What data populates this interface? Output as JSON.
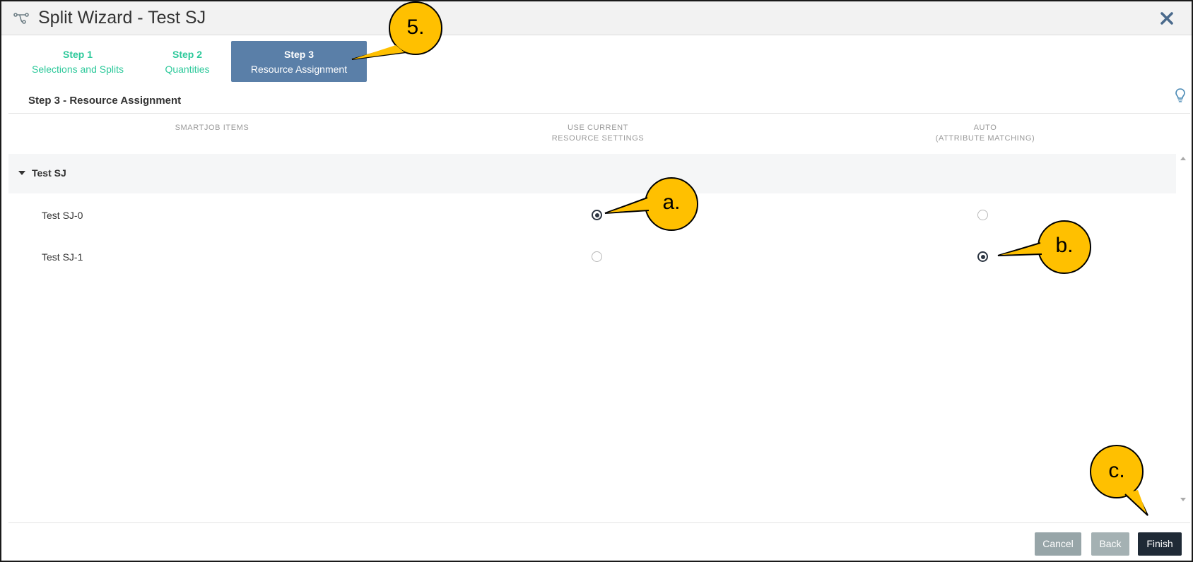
{
  "window": {
    "title": "Split Wizard - Test SJ"
  },
  "steps": [
    {
      "num": "Step 1",
      "label": "Selections and Splits",
      "state": "done"
    },
    {
      "num": "Step 2",
      "label": "Quantities",
      "state": "done"
    },
    {
      "num": "Step 3",
      "label": "Resource Assignment",
      "state": "active"
    }
  ],
  "section": {
    "title": "Step 3 - Resource Assignment"
  },
  "columns": {
    "items": "SMARTJOB ITEMS",
    "current_line1": "USE CURRENT",
    "current_line2": "RESOURCE SETTINGS",
    "auto_line1": "AUTO",
    "auto_line2": "(ATTRIBUTE MATCHING)"
  },
  "group": {
    "label": "Test SJ"
  },
  "rows": [
    {
      "label": "Test SJ-0",
      "use_current": true,
      "auto": false
    },
    {
      "label": "Test SJ-1",
      "use_current": false,
      "auto": true
    }
  ],
  "buttons": {
    "cancel": "Cancel",
    "back": "Back",
    "finish": "Finish"
  },
  "callouts": {
    "step": "5.",
    "a": "a.",
    "b": "b.",
    "c": "c."
  },
  "colors": {
    "step_done": "#2ec99b",
    "step_active_bg": "#5a7fa8",
    "finish_bg": "#1f2a36",
    "callout_fill": "#ffc000"
  }
}
